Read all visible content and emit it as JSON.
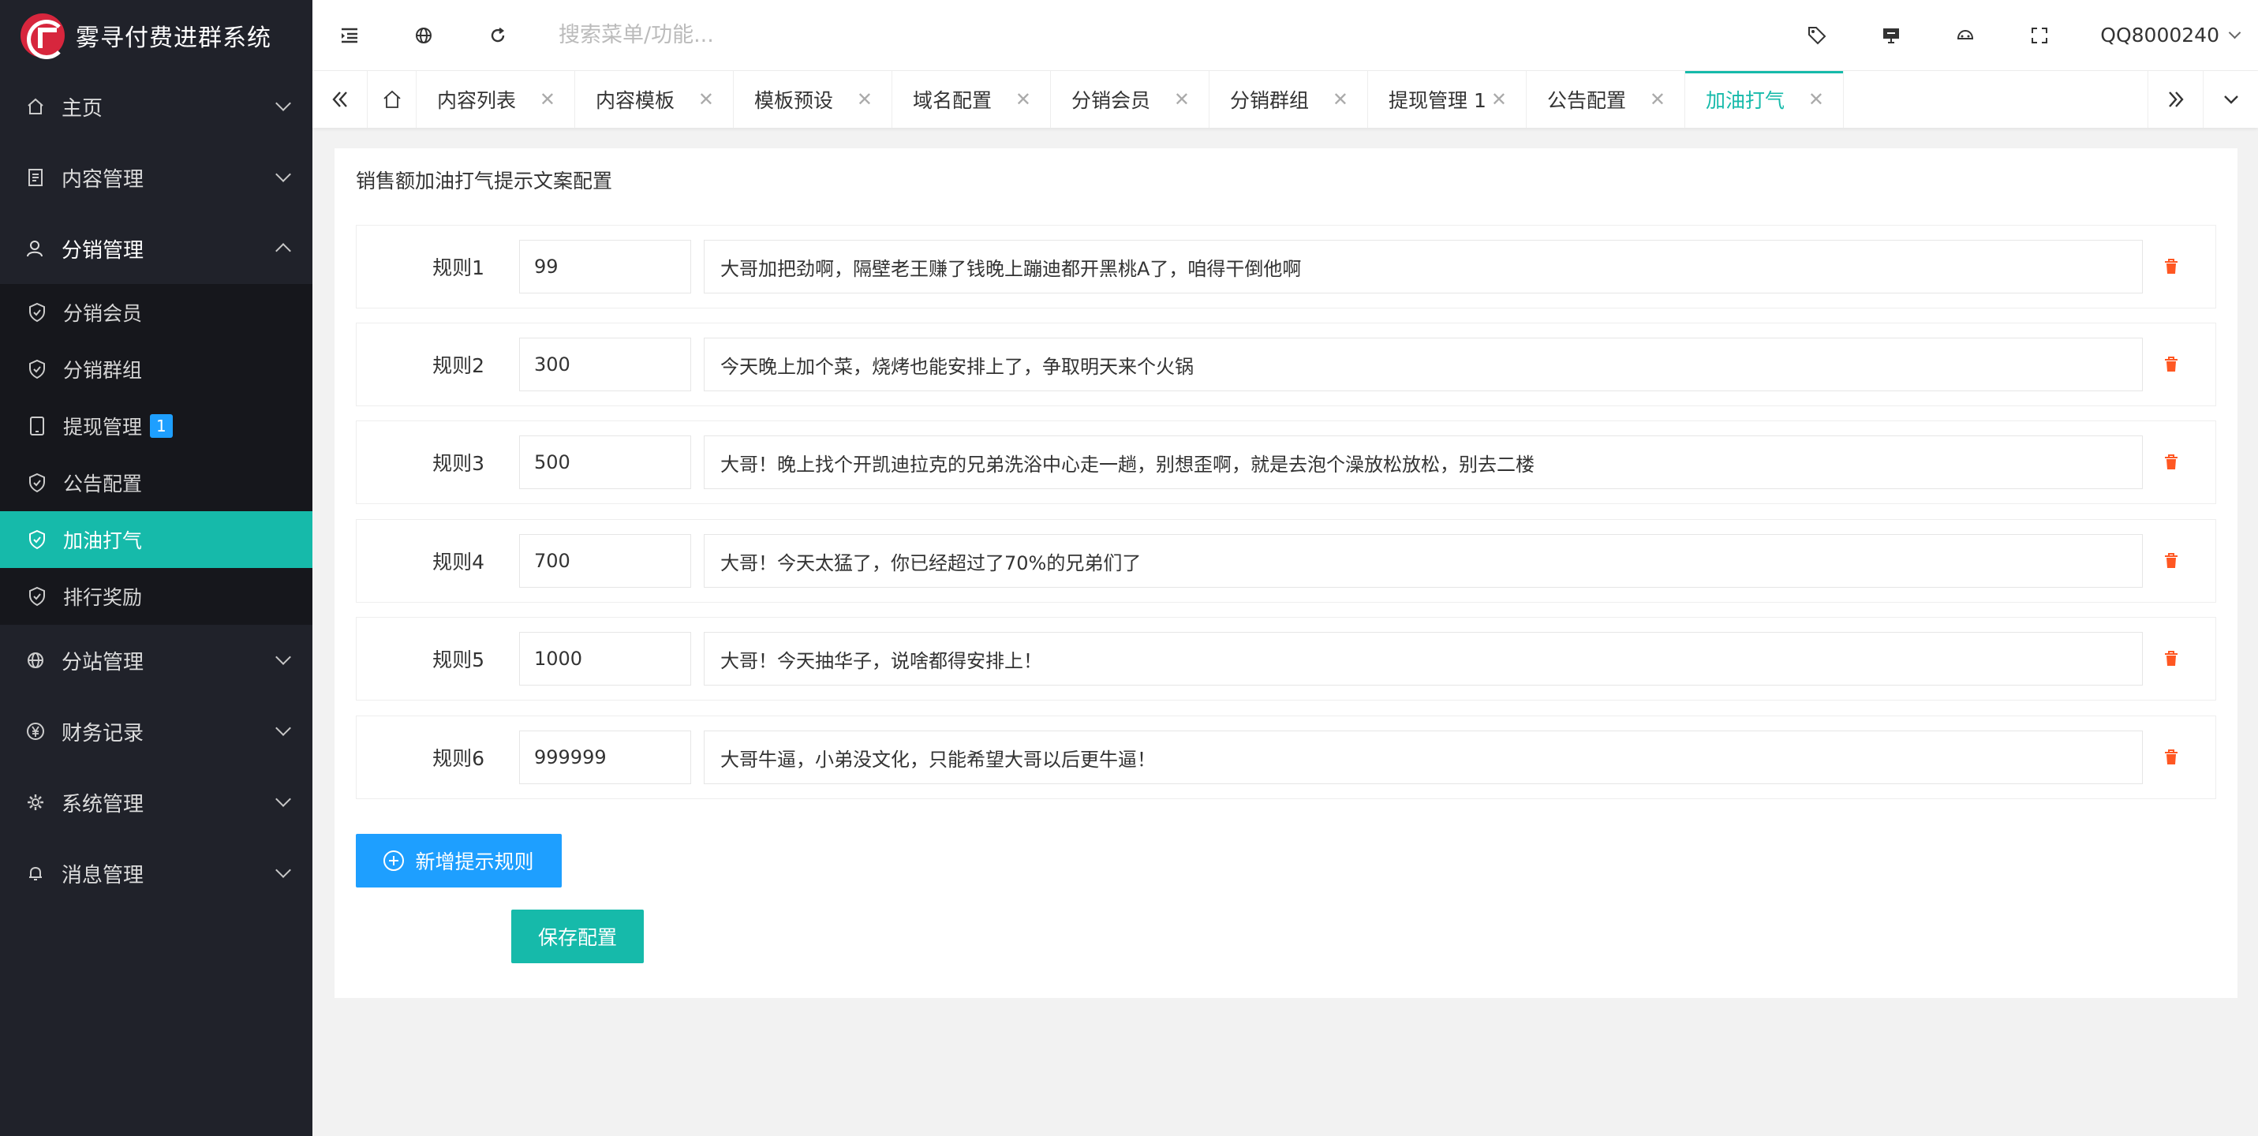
{
  "app": {
    "title": "雾寻付费进群系统"
  },
  "sidebar": {
    "menu": [
      {
        "label": "主页",
        "icon": "home-icon",
        "open": false
      },
      {
        "label": "内容管理",
        "icon": "document-icon",
        "open": false
      },
      {
        "label": "分销管理",
        "icon": "user-icon",
        "open": true
      }
    ],
    "submenu": [
      {
        "label": "分销会员",
        "icon": "shield-check-icon",
        "active": false
      },
      {
        "label": "分销群组",
        "icon": "shield-check-icon",
        "active": false
      },
      {
        "label": "提现管理",
        "icon": "tablet-icon",
        "active": false,
        "badge": "1"
      },
      {
        "label": "公告配置",
        "icon": "shield-check-icon",
        "active": false
      },
      {
        "label": "加油打气",
        "icon": "shield-check-icon",
        "active": true
      },
      {
        "label": "排行奖励",
        "icon": "shield-check-icon",
        "active": false
      }
    ],
    "menu_after": [
      {
        "label": "分站管理",
        "icon": "globe-icon"
      },
      {
        "label": "财务记录",
        "icon": "yen-icon"
      },
      {
        "label": "系统管理",
        "icon": "gear-icon"
      },
      {
        "label": "消息管理",
        "icon": "bell-icon"
      }
    ]
  },
  "header": {
    "search_placeholder": "搜索菜单/功能...",
    "username": "QQ8000240"
  },
  "tabs": [
    {
      "label": "内容列表",
      "active": false
    },
    {
      "label": "内容模板",
      "active": false
    },
    {
      "label": "模板预设",
      "active": false
    },
    {
      "label": "域名配置",
      "active": false
    },
    {
      "label": "分销会员",
      "active": false
    },
    {
      "label": "分销群组",
      "active": false
    },
    {
      "label": "提现管理 1",
      "active": false
    },
    {
      "label": "公告配置",
      "active": false
    },
    {
      "label": "加油打气",
      "active": true
    }
  ],
  "main": {
    "title": "销售额加油打气提示文案配置",
    "rules": [
      {
        "label": "规则1",
        "amount": "99",
        "text": "大哥加把劲啊，隔壁老王赚了钱晚上蹦迪都开黑桃A了，咱得干倒他啊"
      },
      {
        "label": "规则2",
        "amount": "300",
        "text": "今天晚上加个菜，烧烤也能安排上了，争取明天来个火锅"
      },
      {
        "label": "规则3",
        "amount": "500",
        "text": "大哥！晚上找个开凯迪拉克的兄弟洗浴中心走一趟，别想歪啊，就是去泡个澡放松放松，别去二楼"
      },
      {
        "label": "规则4",
        "amount": "700",
        "text": "大哥！今天太猛了，你已经超过了70%的兄弟们了"
      },
      {
        "label": "规则5",
        "amount": "1000",
        "text": "大哥！今天抽华子，说啥都得安排上！"
      },
      {
        "label": "规则6",
        "amount": "999999",
        "text": "大哥牛逼，小弟没文化，只能希望大哥以后更牛逼！"
      }
    ],
    "add_button": "新增提示规则",
    "save_button": "保存配置"
  },
  "colors": {
    "sidebar_bg": "#20222a",
    "accent": "#16baaa",
    "primary": "#1e9fff",
    "danger": "#ff5722"
  }
}
